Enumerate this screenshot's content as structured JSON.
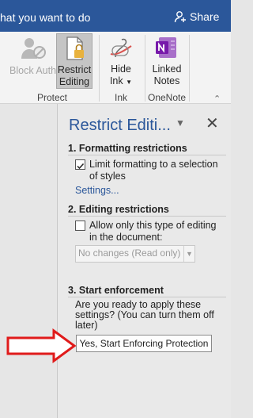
{
  "titlebar": {
    "tellme": "hat you want to do",
    "share": "Share"
  },
  "ribbon": {
    "block_authors": "Block Authors",
    "restrict_editing": [
      "Restrict",
      "Editing"
    ],
    "hide_ink": [
      "Hide",
      "Ink"
    ],
    "linked_notes": [
      "Linked",
      "Notes"
    ],
    "groups": {
      "protect": "Protect",
      "ink": "Ink",
      "onenote": "OneNote"
    }
  },
  "pane": {
    "title": "Restrict Editi...",
    "section1": "1. Formatting restrictions",
    "limit_formatting": "Limit formatting to a selection of styles",
    "limit_checked": true,
    "settings_link": "Settings...",
    "section2": "2. Editing restrictions",
    "allow_only": "Allow only this type of editing in the document:",
    "allow_checked": false,
    "edit_type": "No changes (Read only)",
    "section3": "3. Start enforcement",
    "question": "Are you ready to apply these settings? (You can turn them off later)",
    "start_button": "Yes, Start Enforcing Protection"
  }
}
